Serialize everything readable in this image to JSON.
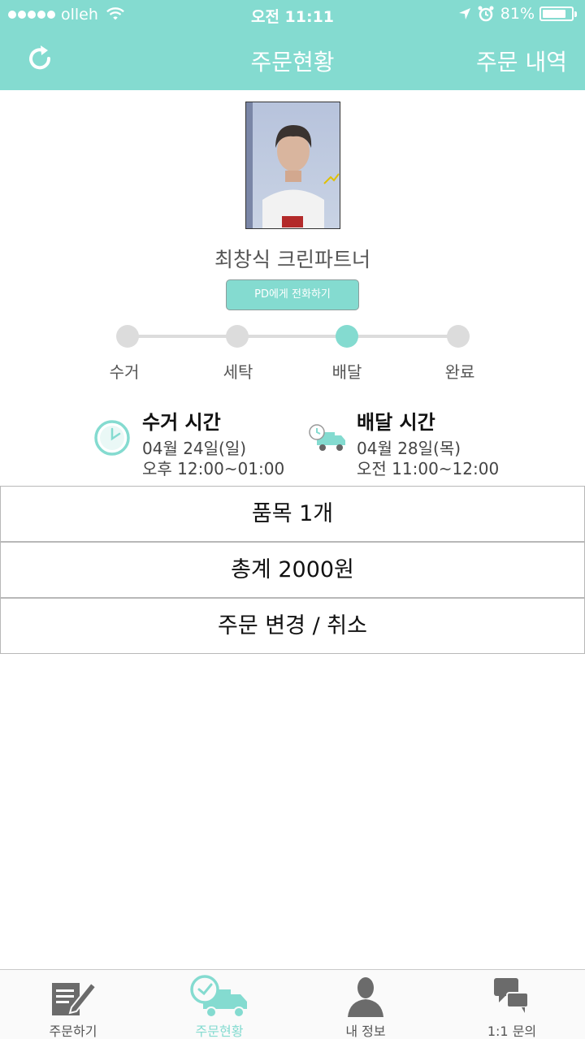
{
  "status_bar": {
    "carrier": "olleh",
    "time": "오전 11:11",
    "battery": "81%",
    "battery_level": 0.81
  },
  "header": {
    "title": "주문현황",
    "right_action": "주문 내역",
    "left_icon": "refresh-icon"
  },
  "partner": {
    "name": "최창식 크린파트너",
    "call_button": "PD에게 전화하기"
  },
  "progress": {
    "steps": [
      "수거",
      "세탁",
      "배달",
      "완료"
    ],
    "active_index": 2
  },
  "pickup": {
    "title": "수거 시간",
    "date": "04월 24일(일)",
    "time": "오후 12:00~01:00",
    "icon": "clock-icon"
  },
  "delivery": {
    "title": "배달 시간",
    "date": "04월 28일(목)",
    "time": "오전 11:00~12:00",
    "icon": "delivery-truck-icon"
  },
  "rows": {
    "items": "품목 1개",
    "total": "총계 2000원",
    "change": "주문 변경 / 취소"
  },
  "tabs": [
    {
      "label": "주문하기",
      "icon": "order-edit-icon"
    },
    {
      "label": "주문현황",
      "icon": "order-status-truck-icon"
    },
    {
      "label": "내 정보",
      "icon": "profile-icon"
    },
    {
      "label": "1:1 문의",
      "icon": "chat-icon"
    }
  ],
  "colors": {
    "accent": "#84dbd0",
    "inactive": "#dcdcdc"
  }
}
